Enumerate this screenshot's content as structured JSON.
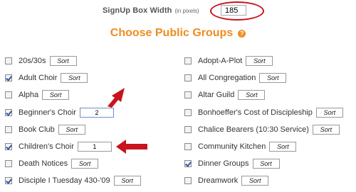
{
  "signup_width": {
    "label": "SignUp Box Width",
    "unit": "(in pixels)",
    "value": "185"
  },
  "title": "Choose Public Groups",
  "help_icon": "?",
  "colors": {
    "accent": "#f08c21",
    "annotation_red": "#c8141c",
    "checkmark": "#2e56a8"
  },
  "left_groups": [
    {
      "name": "20s/30s",
      "checked": false,
      "sort": "Sort"
    },
    {
      "name": "Adult Choir",
      "checked": true,
      "sort": "Sort"
    },
    {
      "name": "Alpha",
      "checked": false,
      "sort": "Sort"
    },
    {
      "name": "Beginner's Choir",
      "checked": true,
      "sort": "2"
    },
    {
      "name": "Book Club",
      "checked": false,
      "sort": "Sort"
    },
    {
      "name": "Children's Choir",
      "checked": true,
      "sort": "1"
    },
    {
      "name": "Death Notices",
      "checked": false,
      "sort": "Sort"
    },
    {
      "name": "Disciple I Tuesday 430-'09",
      "checked": true,
      "sort": "Sort"
    }
  ],
  "right_groups": [
    {
      "name": "Adopt-A-Plot",
      "checked": false,
      "sort": "Sort"
    },
    {
      "name": "All Congregation",
      "checked": false,
      "sort": "Sort"
    },
    {
      "name": "Altar Guild",
      "checked": false,
      "sort": "Sort"
    },
    {
      "name": "Bonhoeffer's Cost of Discipleship",
      "checked": false,
      "sort": "Sort"
    },
    {
      "name": "Chalice Bearers (10:30 Service)",
      "checked": false,
      "sort": "Sort"
    },
    {
      "name": "Community Kitchen",
      "checked": false,
      "sort": "Sort"
    },
    {
      "name": "Dinner Groups",
      "checked": true,
      "sort": "Sort"
    },
    {
      "name": "Dreamwork",
      "checked": false,
      "sort": "Sort"
    }
  ],
  "annotations": {
    "arrows": [
      "red-arrow-icon",
      "red-arrow-icon"
    ]
  }
}
